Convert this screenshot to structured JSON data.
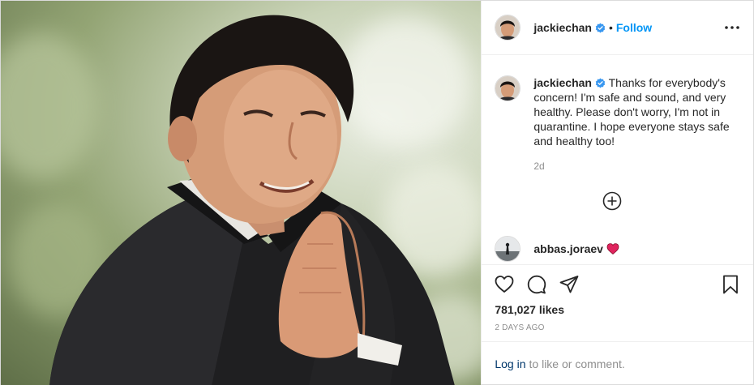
{
  "header": {
    "username": "jackiechan",
    "separator": "•",
    "follow_label": "Follow",
    "more_icon": "more-horizontal-icon"
  },
  "caption": {
    "username": "jackiechan",
    "text": "Thanks for everybody's concern! I'm safe and sound, and very healthy. Please don't worry, I'm not in quarantine. I hope everyone stays safe and healthy too!",
    "time_ago": "2d"
  },
  "load_more_icon": "plus-circle-icon",
  "comment": {
    "username": "abbas.joraev",
    "emoji": "red-heart"
  },
  "actions": {
    "like_icon": "heart-icon",
    "comment_icon": "comment-icon",
    "share_icon": "share-icon",
    "save_icon": "bookmark-icon"
  },
  "likes": "781,027 likes",
  "date": "2 DAYS AGO",
  "login": {
    "link_label": "Log in",
    "rest_text": "to like or comment."
  },
  "colors": {
    "accent": "#0095f6",
    "link": "#00376b",
    "muted": "#8e8e8e",
    "text": "#262626",
    "heart": "#ed4956"
  }
}
